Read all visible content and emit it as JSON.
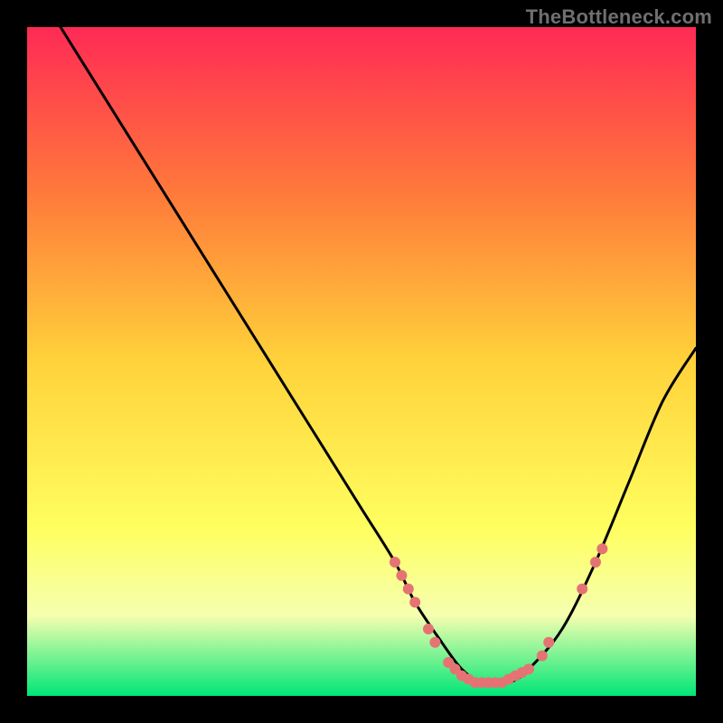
{
  "watermark": "TheBottleneck.com",
  "colors": {
    "top": "#ff2a55",
    "mid_upper": "#ff7a3a",
    "mid": "#ffd23a",
    "mid_lower": "#ffff60",
    "bottom_band": "#f5ffb0",
    "very_bottom": "#00e676",
    "curve": "#000000",
    "dot": "#e57373",
    "frame_bg": "#000000"
  },
  "chart_data": {
    "type": "line",
    "title": "",
    "xlabel": "",
    "ylabel": "",
    "xlim": [
      0,
      100
    ],
    "ylim": [
      0,
      100
    ],
    "series": [
      {
        "name": "bottleneck-curve",
        "x": [
          5,
          10,
          15,
          20,
          25,
          30,
          35,
          40,
          45,
          50,
          55,
          58,
          62,
          65,
          68,
          72,
          75,
          80,
          85,
          90,
          95,
          100
        ],
        "y": [
          100,
          92,
          84,
          76,
          68,
          60,
          52,
          44,
          36,
          28,
          20,
          14,
          8,
          4,
          2,
          2,
          4,
          10,
          20,
          32,
          44,
          52
        ]
      }
    ],
    "dots": [
      {
        "x": 55,
        "y": 20
      },
      {
        "x": 56,
        "y": 18
      },
      {
        "x": 57,
        "y": 16
      },
      {
        "x": 58,
        "y": 14
      },
      {
        "x": 60,
        "y": 10
      },
      {
        "x": 61,
        "y": 8
      },
      {
        "x": 63,
        "y": 5
      },
      {
        "x": 64,
        "y": 4
      },
      {
        "x": 65,
        "y": 3
      },
      {
        "x": 66,
        "y": 2.5
      },
      {
        "x": 67,
        "y": 2
      },
      {
        "x": 68,
        "y": 2
      },
      {
        "x": 69,
        "y": 2
      },
      {
        "x": 70,
        "y": 2
      },
      {
        "x": 71,
        "y": 2
      },
      {
        "x": 72,
        "y": 2.5
      },
      {
        "x": 73,
        "y": 3
      },
      {
        "x": 74,
        "y": 3.5
      },
      {
        "x": 75,
        "y": 4
      },
      {
        "x": 77,
        "y": 6
      },
      {
        "x": 78,
        "y": 8
      },
      {
        "x": 83,
        "y": 16
      },
      {
        "x": 85,
        "y": 20
      },
      {
        "x": 86,
        "y": 22
      }
    ],
    "gradient_stops": [
      {
        "offset": 0.0,
        "key": "top"
      },
      {
        "offset": 0.25,
        "key": "mid_upper"
      },
      {
        "offset": 0.5,
        "key": "mid"
      },
      {
        "offset": 0.75,
        "key": "mid_lower"
      },
      {
        "offset": 0.88,
        "key": "bottom_band"
      },
      {
        "offset": 1.0,
        "key": "very_bottom"
      }
    ]
  }
}
